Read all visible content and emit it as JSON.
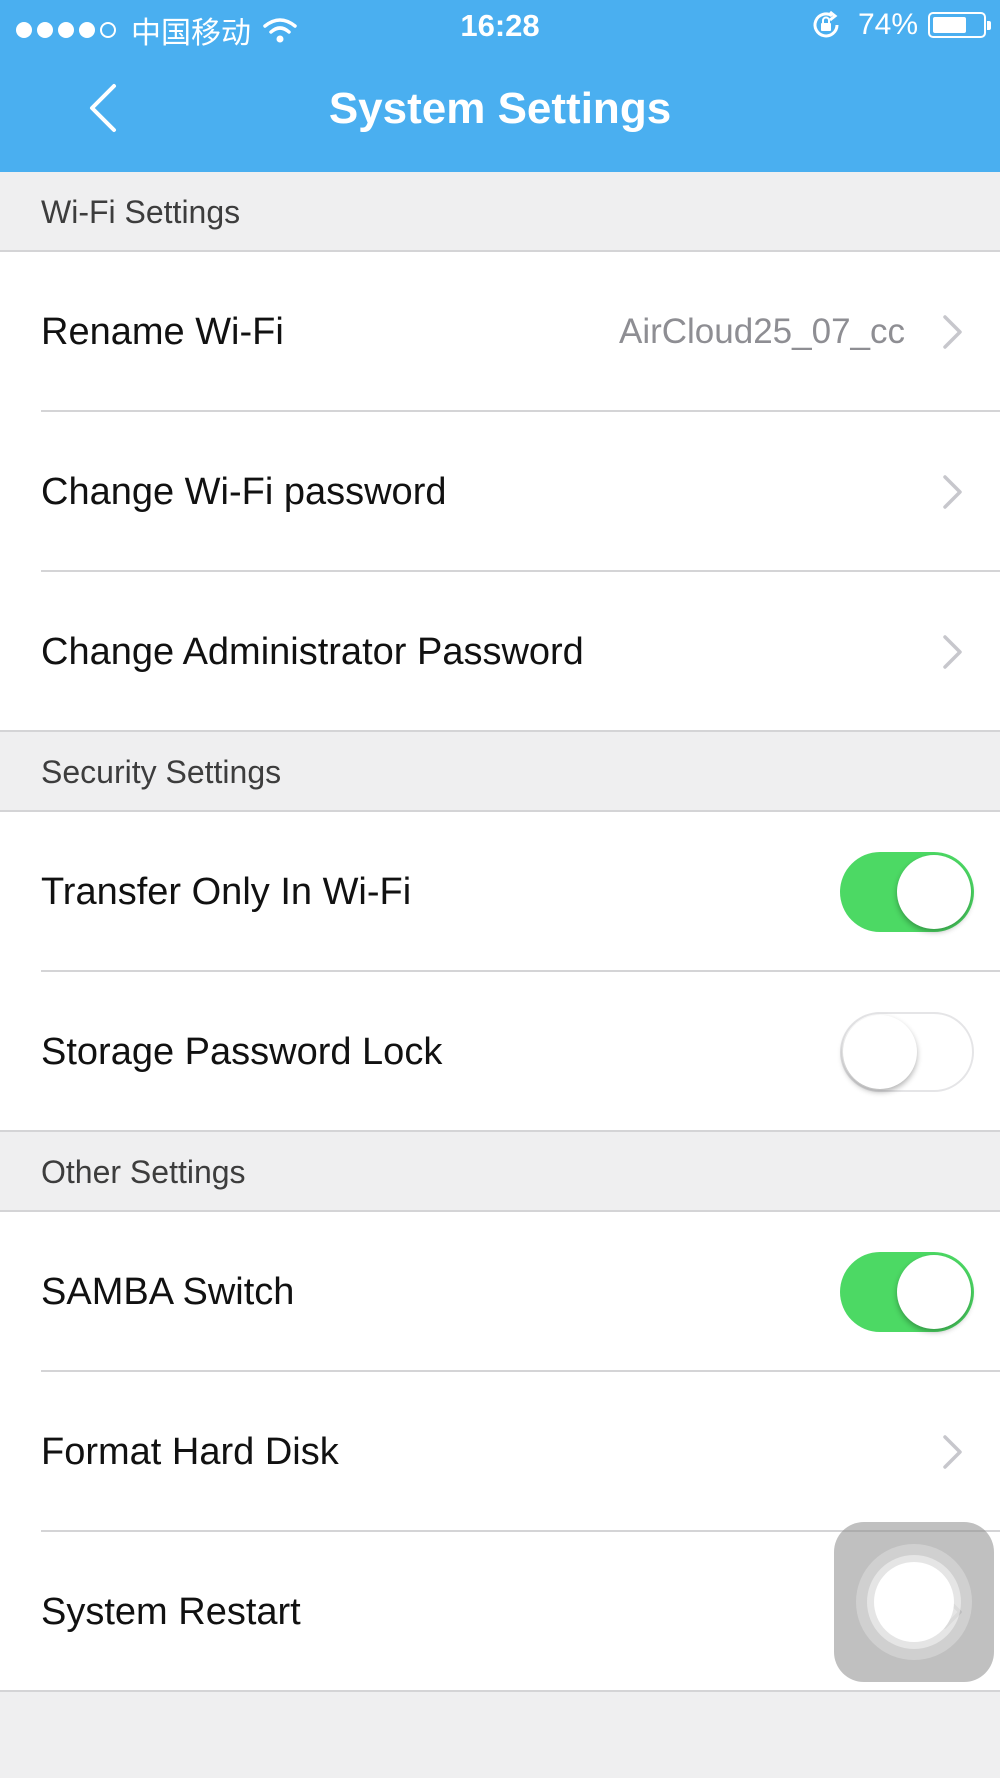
{
  "status_bar": {
    "carrier": "中国移动",
    "time": "16:28",
    "battery": "74%",
    "battery_level": 0.74,
    "signal_bars": 4
  },
  "nav": {
    "title": "System Settings",
    "back_icon": "chevron-left-icon"
  },
  "sections": {
    "wifi": {
      "title": "Wi-Fi Settings",
      "rename": {
        "label": "Rename Wi-Fi",
        "value": "AirCloud25_07_cc"
      },
      "change_wifi_password": {
        "label": "Change Wi-Fi password"
      },
      "change_admin_password": {
        "label": "Change Administrator Password"
      }
    },
    "security": {
      "title": "Security Settings",
      "transfer_only_wifi": {
        "label": "Transfer Only In Wi-Fi",
        "enabled": true
      },
      "storage_password_lock": {
        "label": "Storage Password Lock",
        "enabled": false
      }
    },
    "other": {
      "title": "Other Settings",
      "samba_switch": {
        "label": "SAMBA Switch",
        "enabled": true
      },
      "format_hard_disk": {
        "label": "Format Hard Disk"
      },
      "system_restart": {
        "label": "System Restart"
      }
    }
  },
  "colors": {
    "header": "#4aaff0",
    "toggle_on": "#4cd964",
    "background": "#efeff0"
  }
}
